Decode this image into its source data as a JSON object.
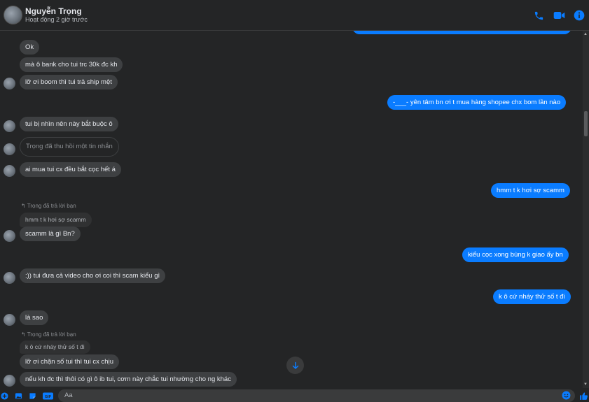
{
  "header": {
    "name": "Nguyễn Trọng",
    "status": "Hoạt động 2 giờ trước"
  },
  "messages": {
    "in_1": "Ok",
    "in_2": "mà ô bank cho tui trc 30k đc kh",
    "in_3": "lỡ ơi boom thì tui trả ship mệt",
    "out_1": "-___- yên tâm bn ơi t mua hàng shopee chx bom lần nào",
    "in_4": "tui bị nhìn nên này bắt buộc ô",
    "recalled": "Trọng đã thu hồi một tin nhắn",
    "in_5": "ai mua tui cx đều bắt cọc hết á",
    "out_2": "hmm t k hơi sợ scamm",
    "reply_note_1": "Trọng đã trả lời bạn",
    "quoted_1": "hmm t k hơi sợ scamm",
    "in_6": "scamm là gì Bn?",
    "out_3": "kiểu cọc xong bùng k giao ấy bn",
    "in_7": ":)) tui đưa cả video cho ơi coi thì scam kiểu gì",
    "out_4": "k ô cứ nháy thử số t đi",
    "in_8": "là sao",
    "reply_note_2": "Trọng đã trả lời bạn",
    "quoted_2": "k ô cứ nháy thử số t đi",
    "in_9": "lỡ ơi chặn số tui thì tui cx chịu",
    "in_10": "nếu kh đc thì thôi có gì ô ib tui, cơm này chắc tui nhường cho ng khác"
  },
  "composer": {
    "placeholder": "Aa"
  },
  "colors": {
    "accent": "#0a7cff",
    "background": "#242526",
    "incoming_bubble": "#3e4042"
  }
}
